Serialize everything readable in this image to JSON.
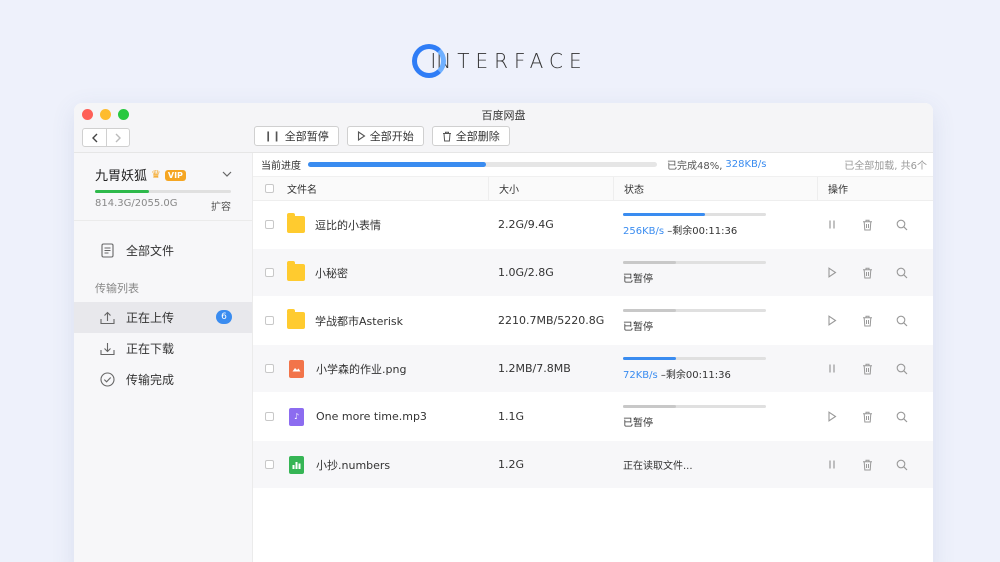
{
  "brand": {
    "text": "NTERFACE"
  },
  "window": {
    "title": "百度网盘"
  },
  "colors": {
    "accent": "#3a8cf0",
    "quota": "#2eb94b",
    "badge": "#3a8cf0"
  },
  "toolbar": {
    "pause_all": "全部暂停",
    "start_all": "全部开始",
    "delete_all": "全部删除"
  },
  "user": {
    "name": "九胃妖狐",
    "vip": "VIP",
    "quota_text": "814.3G/2055.0G",
    "quota_fraction": 0.396,
    "expand": "扩容"
  },
  "sidebar": {
    "all_files": "全部文件",
    "section_label": "传输列表",
    "uploading": "正在上传",
    "upload_count": "6",
    "downloading": "正在下载",
    "completed": "传输完成"
  },
  "progress": {
    "label": "当前进度",
    "fraction": 0.51,
    "done_text": "已完成48%,",
    "speed": "328KB/s",
    "right_text": "已全部加载, 共6个"
  },
  "table": {
    "headers": {
      "name": "文件名",
      "size": "大小",
      "status": "状态",
      "ops": "操作"
    },
    "rows": [
      {
        "name": "逗比的小表情",
        "icon": "folder-icon",
        "size": "2.2G/9.4G",
        "progress": 0.57,
        "running": true,
        "speed": "256KB/s",
        "remaining": " –剩余00:11:36",
        "status": ""
      },
      {
        "name": "小秘密",
        "icon": "folder-icon",
        "size": "1.0G/2.8G",
        "progress": 0.37,
        "running": false,
        "speed": "",
        "remaining": "",
        "status": "已暂停"
      },
      {
        "name": "学战都市Asterisk",
        "icon": "folder-icon",
        "size": "2210.7MB/5220.8G",
        "progress": 0.37,
        "running": false,
        "speed": "",
        "remaining": "",
        "status": "已暂停"
      },
      {
        "name": "小学森的作业.png",
        "icon": "image-file-icon",
        "size": "1.2MB/7.8MB",
        "progress": 0.37,
        "running": true,
        "speed": "72KB/s",
        "remaining": " –剩余00:11:36",
        "status": ""
      },
      {
        "name": "One more time.mp3",
        "icon": "audio-file-icon",
        "size": "1.1G",
        "progress": 0.37,
        "running": false,
        "speed": "",
        "remaining": "",
        "status": "已暂停"
      },
      {
        "name": "小抄.numbers",
        "icon": "numbers-file-icon",
        "size": "1.2G",
        "progress": null,
        "running": true,
        "speed": "",
        "remaining": "",
        "status": "正在读取文件..."
      }
    ]
  }
}
